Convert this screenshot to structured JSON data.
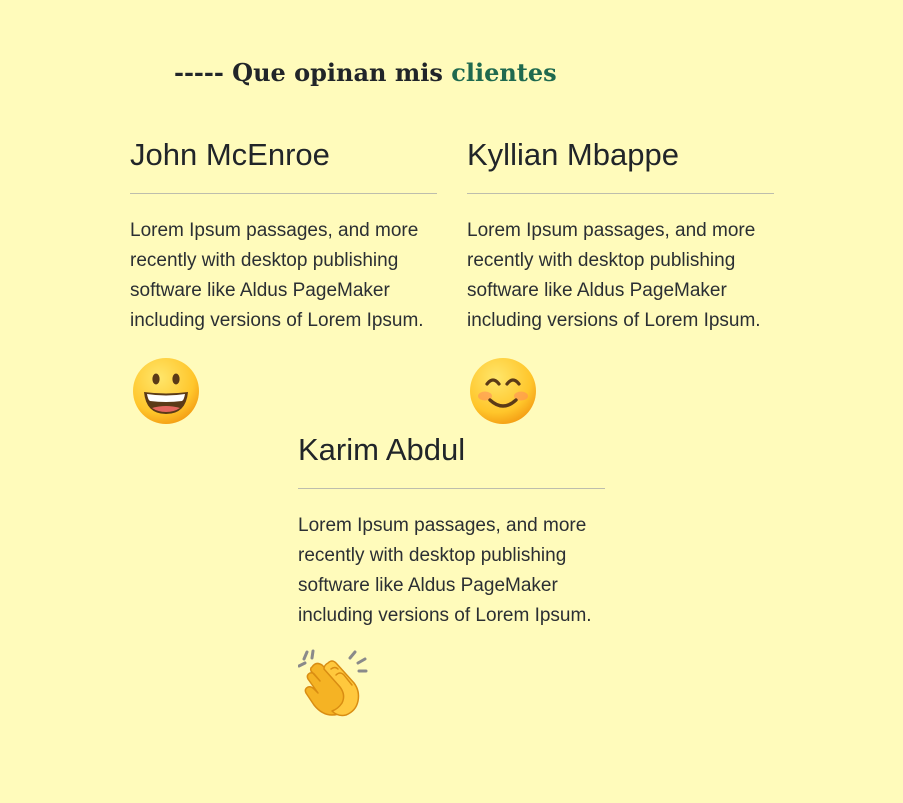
{
  "section": {
    "heading_prefix": "----- Que opinan mis",
    "heading_accent": "clientes",
    "accent_color": "#1f6a4f",
    "background_color": "#fffbbb"
  },
  "testimonials": [
    {
      "name": "John McEnroe",
      "text": "Lorem Ipsum passages, and more recently with desktop publishing software like Aldus PageMaker including versions of Lorem Ipsum.",
      "emoji": "grinning-face-icon"
    },
    {
      "name": "Kyllian Mbappe",
      "text": "Lorem Ipsum passages, and more recently with desktop publishing software like Aldus PageMaker including versions of Lorem Ipsum.",
      "emoji": "smiling-face-with-smiling-eyes-icon"
    },
    {
      "name": "Karim Abdul",
      "text": "Lorem Ipsum passages, and more recently with desktop publishing software like Aldus PageMaker including versions of Lorem Ipsum.",
      "emoji": "clapping-hands-icon"
    }
  ]
}
